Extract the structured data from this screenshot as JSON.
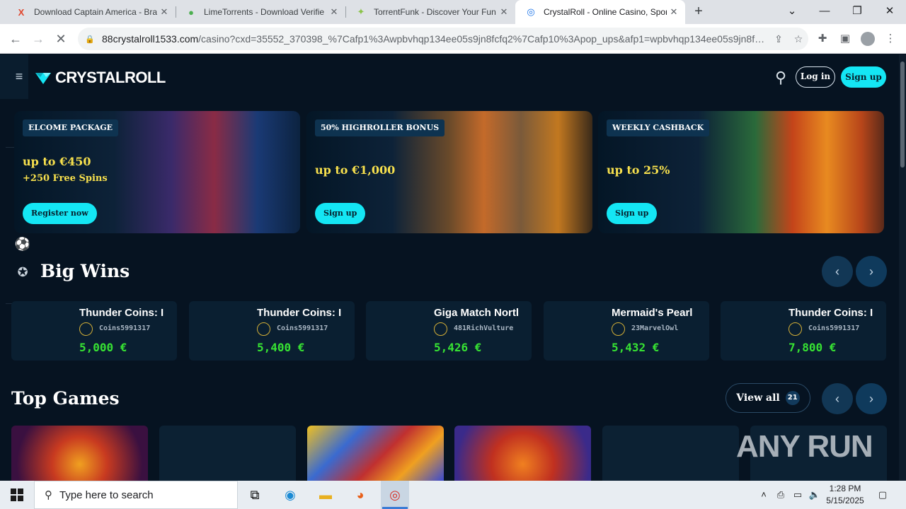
{
  "browser": {
    "tabs": [
      {
        "title": "Download Captain America - Bra",
        "favicon": "x-logo-icon",
        "active": false
      },
      {
        "title": "LimeTorrents - Download Verifie",
        "favicon": "lime-icon",
        "active": false
      },
      {
        "title": "TorrentFunk - Discover Your Fun",
        "favicon": "torrentfunk-icon",
        "active": false
      },
      {
        "title": "CrystalRoll - Online Casino, Spor",
        "favicon": "crystalroll-icon",
        "active": true
      }
    ],
    "url_domain": "88crystalroll1533.com",
    "url_path": "/casino?cxd=35552_370398_%7Cafp1%3Awpbvhqp134ee05s9jn8fcfq2%7Cafp10%3Apop_ups&afp1=wpbvhqp134ee05s9jn8fcf..."
  },
  "site": {
    "logo_text": "CRYSTALROLL",
    "login_label": "Log in",
    "signup_label": "Sign up",
    "accent_color": "#14e6f4"
  },
  "promos": [
    {
      "tag": "ELCOME PACKAGE",
      "amount": "up to €450",
      "extra": "+250 Free Spins",
      "cta": "Register now"
    },
    {
      "tag": "50% HIGHROLLER BONUS",
      "amount": "up to €1,000",
      "extra": "",
      "cta": "Sign up"
    },
    {
      "tag": "WEEKLY CASHBACK",
      "amount": "up to 25%",
      "extra": "",
      "cta": "Sign up"
    }
  ],
  "big_wins": {
    "title": "Big Wins",
    "items": [
      {
        "game": "Thunder Coins: I",
        "user": "Coins5991317",
        "amount": "5,000 €"
      },
      {
        "game": "Thunder Coins: I",
        "user": "Coins5991317",
        "amount": "5,400 €"
      },
      {
        "game": "Giga Match Nortl",
        "user": "481RichVulture",
        "amount": "5,426 €"
      },
      {
        "game": "Mermaid's Pearl",
        "user": "23MarvelOwl",
        "amount": "5,432 €"
      },
      {
        "game": "Thunder Coins: I",
        "user": "Coins5991317",
        "amount": "7,800 €"
      }
    ]
  },
  "top_games": {
    "title": "Top Games",
    "view_all_label": "View all",
    "count": "21"
  },
  "watermark": "ANY RUN",
  "taskbar": {
    "search_placeholder": "Type here to search",
    "time": "1:28 PM",
    "date": "5/15/2025"
  }
}
